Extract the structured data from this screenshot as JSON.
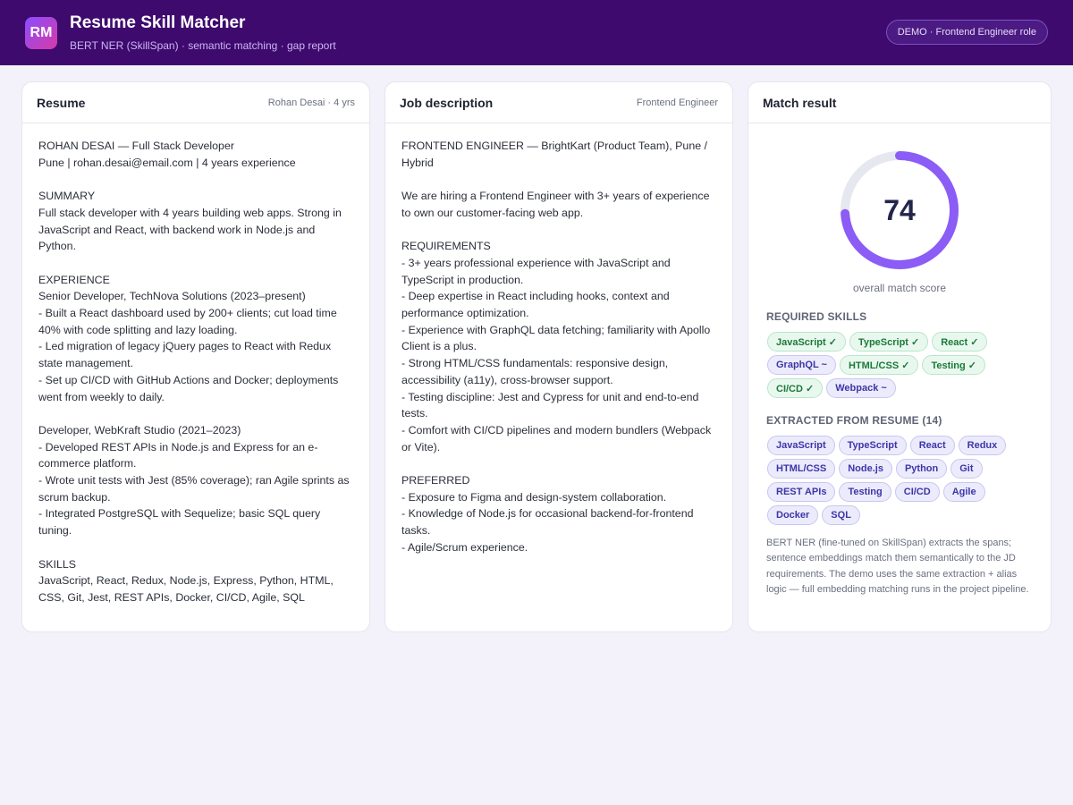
{
  "header": {
    "logo_text": "RM",
    "title": "Resume Skill Matcher",
    "subtitle": "BERT NER (SkillSpan) · semantic matching · gap report",
    "demo_label": "DEMO · Frontend Engineer role"
  },
  "resume": {
    "title": "Resume",
    "meta": "Rohan Desai · 4 yrs",
    "text": "ROHAN DESAI — Full Stack Developer\nPune | rohan.desai@email.com | 4 years experience\n\nSUMMARY\nFull stack developer with 4 years building web apps. Strong in\nJavaScript and React, with backend work in Node.js and\nPython.\n\nEXPERIENCE\nSenior Developer, TechNova Solutions (2023–present)\n- Built a React dashboard used by 200+ clients; cut load time\n40% with code splitting and lazy loading.\n- Led migration of legacy jQuery pages to React with Redux\nstate management.\n- Set up CI/CD with GitHub Actions and Docker; deployments\nwent from weekly to daily.\n\nDeveloper, WebKraft Studio (2021–2023)\n- Developed REST APIs in Node.js and Express for an e-\ncommerce platform.\n- Wrote unit tests with Jest (85% coverage); ran Agile sprints as\nscrum backup.\n- Integrated PostgreSQL with Sequelize; basic SQL query\ntuning.\n\nSKILLS\nJavaScript, React, Redux, Node.js, Express, Python, HTML,\nCSS, Git, Jest, REST APIs, Docker, CI/CD, Agile, SQL"
  },
  "job": {
    "title": "Job description",
    "meta": "Frontend Engineer",
    "text": "FRONTEND ENGINEER — BrightKart (Product Team), Pune /\nHybrid\n\nWe are hiring a Frontend Engineer with 3+ years of experience\nto own our customer-facing web app.\n\nREQUIREMENTS\n- 3+ years professional experience with JavaScript and\nTypeScript in production.\n- Deep expertise in React including hooks, context and\nperformance optimization.\n- Experience with GraphQL data fetching; familiarity with Apollo\nClient is a plus.\n- Strong HTML/CSS fundamentals: responsive design,\naccessibility (a11y), cross-browser support.\n- Testing discipline: Jest and Cypress for unit and end-to-end\ntests.\n- Comfort with CI/CD pipelines and modern bundlers (Webpack\nor Vite).\n\nPREFERRED\n- Exposure to Figma and design-system collaboration.\n- Knowledge of Node.js for occasional backend-for-frontend\ntasks.\n- Agile/Scrum experience."
  },
  "match": {
    "title": "Match result",
    "score": 74,
    "score_fraction": 0.74,
    "score_caption": "overall match score",
    "colors": {
      "ring": "#8b5cf6",
      "track": "#e6e8ef",
      "matched": "#1b7a3a",
      "partial": "#3d36a8"
    },
    "required_label": "REQUIRED SKILLS",
    "required_skills": [
      {
        "label": "JavaScript ✓",
        "status": "matched"
      },
      {
        "label": "TypeScript ✓",
        "status": "matched"
      },
      {
        "label": "React ✓",
        "status": "matched"
      },
      {
        "label": "GraphQL ~",
        "status": "partial"
      },
      {
        "label": "HTML/CSS ✓",
        "status": "matched"
      },
      {
        "label": "Testing ✓",
        "status": "matched"
      },
      {
        "label": "CI/CD ✓",
        "status": "matched"
      },
      {
        "label": "Webpack ~",
        "status": "partial"
      }
    ],
    "extracted_label": "EXTRACTED FROM RESUME (14)",
    "extracted_skills": [
      "JavaScript",
      "TypeScript",
      "React",
      "Redux",
      "HTML/CSS",
      "Node.js",
      "Python",
      "Git",
      "REST APIs",
      "Testing",
      "CI/CD",
      "Agile",
      "Docker",
      "SQL"
    ],
    "note": "BERT NER (fine-tuned on SkillSpan) extracts the spans; sentence embeddings match them semantically to the JD requirements. The demo uses the same extraction + alias logic — full embedding matching runs in the project pipeline."
  }
}
